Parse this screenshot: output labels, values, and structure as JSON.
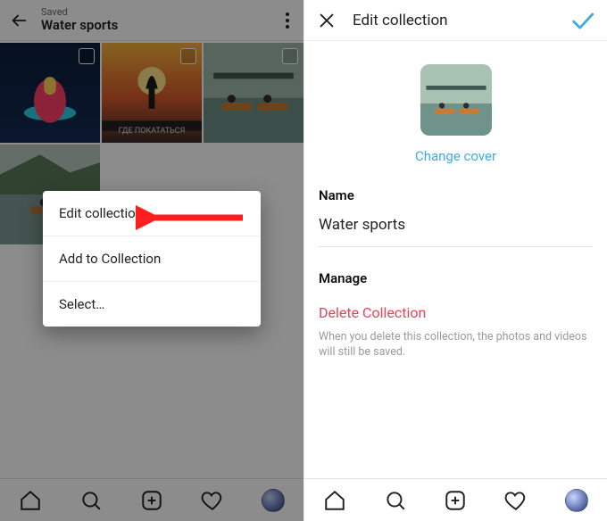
{
  "left": {
    "header": {
      "sub": "Saved",
      "title": "Water sports"
    },
    "grid_count": 4,
    "popup": {
      "edit": "Edit collection",
      "add": "Add to Collection",
      "select": "Select…"
    }
  },
  "right": {
    "header_title": "Edit collection",
    "change_cover": "Change cover",
    "name_label": "Name",
    "name_value": "Water sports",
    "manage_label": "Manage",
    "delete_label": "Delete Collection",
    "delete_help": "When you delete this collection, the photos and videos will still be saved."
  },
  "colors": {
    "accent": "#3dade0",
    "danger": "#e1435b"
  }
}
